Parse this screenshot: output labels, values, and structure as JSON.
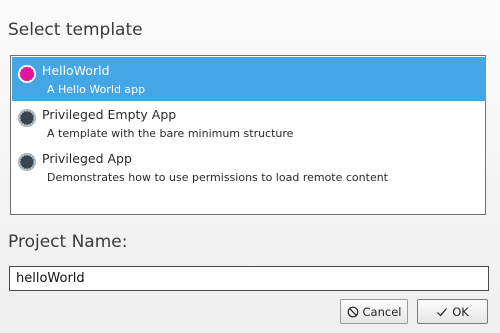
{
  "dialog": {
    "select_title": "Select template",
    "project_name_label": "Project Name:"
  },
  "templates": [
    {
      "name": "HelloWorld",
      "description": "A Hello World app",
      "icon": "pink-circle-icon",
      "selected": true
    },
    {
      "name": "Privileged Empty App",
      "description": "A template with the bare minimum structure",
      "icon": "dark-gear-circle-icon",
      "selected": false
    },
    {
      "name": "Privileged App",
      "description": "Demonstrates how to use permissions to load remote content",
      "icon": "dark-gear-circle-icon",
      "selected": false
    }
  ],
  "project_name": {
    "value": "helloWorld"
  },
  "buttons": {
    "cancel_label": "Cancel",
    "cancel_icon": "cancel-icon",
    "ok_label": "OK",
    "ok_icon": "checkmark-icon"
  },
  "colors": {
    "selection": "#45a6e6",
    "hello_icon": "#e0169a"
  }
}
